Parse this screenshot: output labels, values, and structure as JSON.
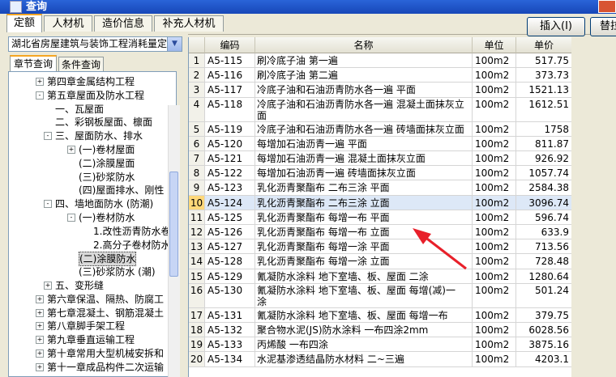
{
  "window": {
    "title": "查询"
  },
  "tabs": [
    {
      "label": "定额",
      "active": true
    },
    {
      "label": "人材机",
      "active": false
    },
    {
      "label": "造价信息",
      "active": false
    },
    {
      "label": "补充人材机",
      "active": false
    }
  ],
  "buttons": {
    "insert": "插入(I)",
    "replace": "替拉"
  },
  "left": {
    "quota_select": "湖北省房屋建筑与装饰工程消耗量定",
    "subtabs": [
      {
        "label": "章节查询",
        "active": true
      },
      {
        "label": "条件查询",
        "active": false
      }
    ],
    "tree": [
      {
        "label": "第四章金属结构工程",
        "level": 0,
        "toggle": "+"
      },
      {
        "label": "第五章屋面及防水工程",
        "level": 0,
        "toggle": "-"
      },
      {
        "label": "一、瓦屋面",
        "level": 1,
        "toggle": ""
      },
      {
        "label": "二、彩钢板屋面、檩面",
        "level": 1,
        "toggle": ""
      },
      {
        "label": "三、屋面防水、排水",
        "level": 1,
        "toggle": "-"
      },
      {
        "label": "(一)卷材屋面",
        "level": 2,
        "toggle": "+"
      },
      {
        "label": "(二)涂膜屋面",
        "level": 2,
        "toggle": ""
      },
      {
        "label": "(三)砂浆防水",
        "level": 2,
        "toggle": ""
      },
      {
        "label": "(四)屋面排水、刚性",
        "level": 2,
        "toggle": ""
      },
      {
        "label": "四、墙地面防水 (防潮)",
        "level": 1,
        "toggle": "-"
      },
      {
        "label": "(一)卷材防水",
        "level": 2,
        "toggle": "-"
      },
      {
        "label": "1.改性沥青防水卷",
        "level": 3,
        "toggle": ""
      },
      {
        "label": "2.高分子卷材防水",
        "level": 3,
        "toggle": ""
      },
      {
        "label": "(二)涂膜防水",
        "level": 2,
        "toggle": "",
        "selected": true
      },
      {
        "label": "(三)砂浆防水 (潮)",
        "level": 2,
        "toggle": ""
      },
      {
        "label": "五、变形缝",
        "level": 1,
        "toggle": "+"
      },
      {
        "label": "第六章保温、隔热、防腐工",
        "level": 0,
        "toggle": "+"
      },
      {
        "label": "第七章混凝土、钢筋混凝土",
        "level": 0,
        "toggle": "+"
      },
      {
        "label": "第八章脚手架工程",
        "level": 0,
        "toggle": "+"
      },
      {
        "label": "第九章垂直运输工程",
        "level": 0,
        "toggle": "+"
      },
      {
        "label": "第十章常用大型机械安拆和",
        "level": 0,
        "toggle": "+"
      },
      {
        "label": "第十一章成品构件二次运输",
        "level": 0,
        "toggle": "+"
      }
    ]
  },
  "grid": {
    "headers": {
      "code": "编码",
      "name": "名称",
      "unit": "单位",
      "price": "单价"
    },
    "rows": [
      {
        "no": "1",
        "code": "A5-115",
        "name": "刷冷底子油 第一遍",
        "unit": "100m2",
        "price": "517.75"
      },
      {
        "no": "2",
        "code": "A5-116",
        "name": "刷冷底子油 第二遍",
        "unit": "100m2",
        "price": "373.73"
      },
      {
        "no": "3",
        "code": "A5-117",
        "name": "冷底子油和石油沥青防水各一遍 平面",
        "unit": "100m2",
        "price": "1521.13"
      },
      {
        "no": "4",
        "code": "A5-118",
        "name": "冷底子油和石油沥青防水各一遍 混凝土面抹灰立",
        "name2": "面",
        "unit": "100m2",
        "price": "1612.51"
      },
      {
        "no": "5",
        "code": "A5-119",
        "name": "冷底子油和石油沥青防水各一遍 砖墙面抹灰立面",
        "unit": "100m2",
        "price": "1758"
      },
      {
        "no": "6",
        "code": "A5-120",
        "name": "每增加石油沥青一遍 平面",
        "unit": "100m2",
        "price": "811.87"
      },
      {
        "no": "7",
        "code": "A5-121",
        "name": "每增加石油沥青一遍 混凝土面抹灰立面",
        "unit": "100m2",
        "price": "926.92"
      },
      {
        "no": "8",
        "code": "A5-122",
        "name": "每增加石油沥青一遍 砖墙面抹灰立面",
        "unit": "100m2",
        "price": "1057.74"
      },
      {
        "no": "9",
        "code": "A5-123",
        "name": "乳化沥青聚酯布 二布三涂 平面",
        "unit": "100m2",
        "price": "2584.38"
      },
      {
        "no": "10",
        "code": "A5-124",
        "name": "乳化沥青聚酯布 二布三涂 立面",
        "unit": "100m2",
        "price": "3096.74",
        "selected": true
      },
      {
        "no": "11",
        "code": "A5-125",
        "name": "乳化沥青聚酯布 每增一布 平面",
        "unit": "100m2",
        "price": "596.74"
      },
      {
        "no": "12",
        "code": "A5-126",
        "name": "乳化沥青聚酯布 每增一布 立面",
        "unit": "100m2",
        "price": "633.9"
      },
      {
        "no": "13",
        "code": "A5-127",
        "name": "乳化沥青聚酯布 每增一涂 平面",
        "unit": "100m2",
        "price": "713.56"
      },
      {
        "no": "14",
        "code": "A5-128",
        "name": "乳化沥青聚酯布 每增一涂 立面",
        "unit": "100m2",
        "price": "728.48"
      },
      {
        "no": "15",
        "code": "A5-129",
        "name": "氰凝防水涂料 地下室墙、板、屋面 二涂",
        "unit": "100m2",
        "price": "1280.64"
      },
      {
        "no": "16",
        "code": "A5-130",
        "name": "氰凝防水涂料 地下室墙、板、屋面 每增(减)一",
        "name2": "涂",
        "unit": "100m2",
        "price": "501.24"
      },
      {
        "no": "17",
        "code": "A5-131",
        "name": "氰凝防水涂料 地下室墙、板、屋面 每增一布",
        "unit": "100m2",
        "price": "379.75"
      },
      {
        "no": "18",
        "code": "A5-132",
        "name": "聚合物水泥(JS)防水涂料 一布四涂2mm",
        "unit": "100m2",
        "price": "6028.56"
      },
      {
        "no": "19",
        "code": "A5-133",
        "name": "丙烯酸 一布四涂",
        "unit": "100m2",
        "price": "3875.16"
      },
      {
        "no": "20",
        "code": "A5-134",
        "name": "水泥基渗透结晶防水材料 二~三遍",
        "unit": "100m2",
        "price": "4203.1"
      }
    ]
  },
  "colors": {
    "annotation_arrow": "#e8202a",
    "selected_row": "#dde8f7"
  }
}
